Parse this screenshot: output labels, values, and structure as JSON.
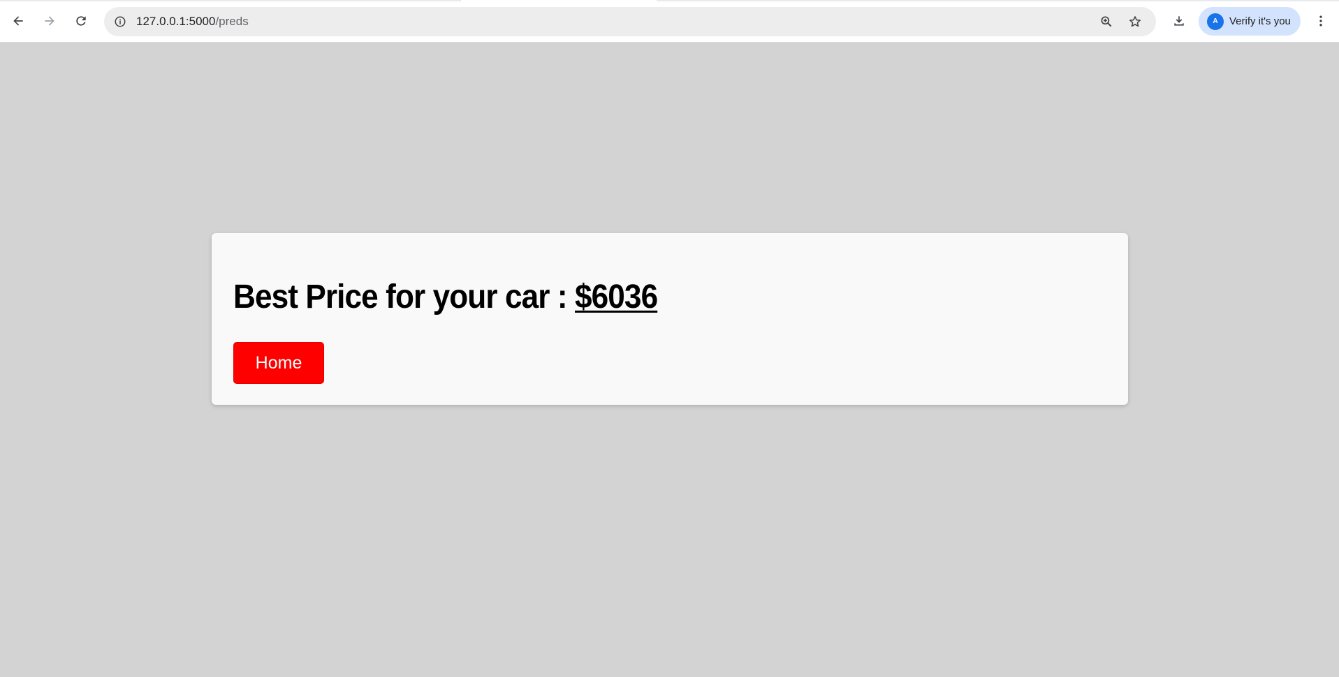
{
  "browser": {
    "url_host": "127.0.0.1:5000",
    "url_path": "/preds",
    "profile_label": "Verify it's you",
    "profile_initial": "A",
    "icons": [
      "back-icon",
      "forward-icon",
      "reload-icon",
      "site-info-icon",
      "zoom-icon",
      "bookmark-star-icon",
      "download-icon",
      "menu-kebab-icon"
    ]
  },
  "page": {
    "background": "#d3d3d3",
    "card_background": "#f9f9f9",
    "headline_prefix": "Best Price for your car : ",
    "price": "$6036",
    "home_button_label": "Home",
    "home_button_color": "#ff0000"
  }
}
